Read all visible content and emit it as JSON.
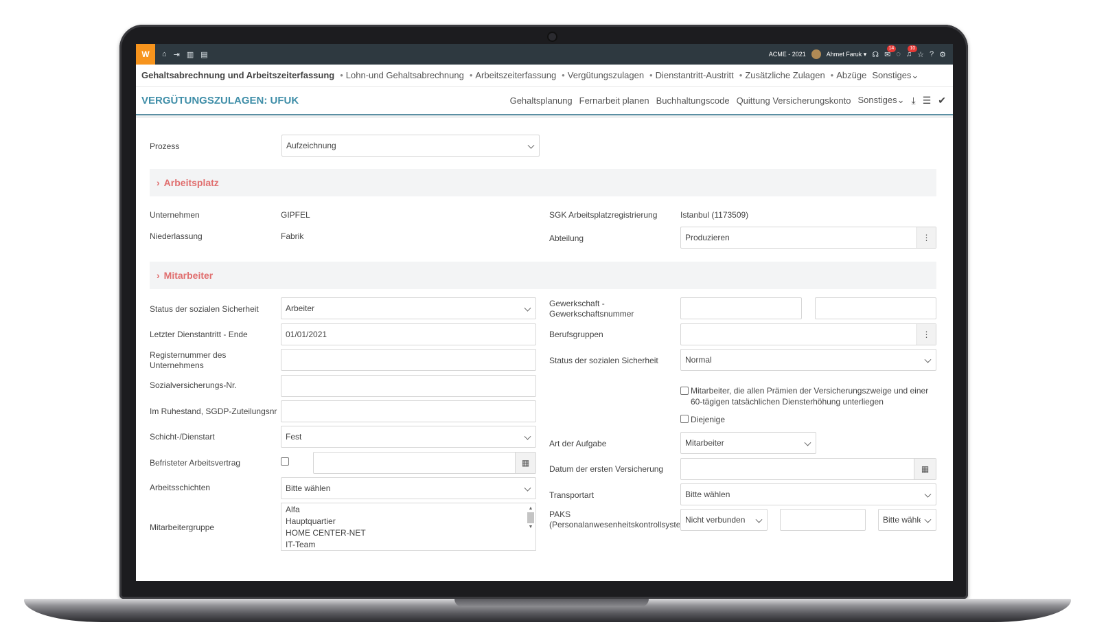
{
  "topbar": {
    "logo": "W",
    "company": "ACME - 2021",
    "user": "Ahmet Faruk",
    "messages_badge": "14",
    "notifications_badge": "10",
    "icons": [
      "home-icon",
      "logout-icon",
      "chart-icon",
      "calendar-icon"
    ]
  },
  "nav": {
    "items": [
      "Gehaltsabrechnung und Arbeitszeiterfassung",
      "Lohn-und Gehaltsabrechnung",
      "Arbeitszeiterfassung",
      "Vergütungszulagen",
      "Dienstantritt-Austritt",
      "Zusätzliche Zulagen",
      "Abzüge",
      "Sonstiges"
    ]
  },
  "title": {
    "text": "VERGÜTUNGSZULAGEN: UFUK",
    "links": [
      "Gehaltsplanung",
      "Fernarbeit planen",
      "Buchhaltungscode",
      "Quittung Versicherungskonto",
      "Sonstiges"
    ]
  },
  "prozess": {
    "label": "Prozess",
    "value": "Aufzeichnung"
  },
  "arbeitsplatz": {
    "title": "Arbeitsplatz",
    "unternehmen_label": "Unternehmen",
    "unternehmen_value": "GIPFEL",
    "niederlassung_label": "Niederlassung",
    "niederlassung_value": "Fabrik",
    "sgk_label": "SGK Arbeitsplatzregistrierung",
    "sgk_value": "Istanbul (1173509)",
    "abteilung_label": "Abteilung",
    "abteilung_value": "Produzieren"
  },
  "mitarbeiter": {
    "title": "Mitarbeiter",
    "status_label": "Status der sozialen Sicherheit",
    "status_value": "Arbeiter",
    "letzter_label": "Letzter Dienstantritt - Ende",
    "letzter_value": "01/01/2021",
    "register_label": "Registernummer des Unternehmens",
    "sozial_label": "Sozialversicherungs-Nr.",
    "ruhestand_label": "Im Ruhestand, SGDP-Zuteilungsnr",
    "schicht_label": "Schicht-/Dienstart",
    "schicht_value": "Fest",
    "befristet_label": "Befristeter Arbeitsvertrag",
    "arbeitsschichten_label": "Arbeitsschichten",
    "arbeitsschichten_value": "Bitte wählen",
    "gruppe_label": "Mitarbeitergruppe",
    "gruppe_options": [
      "Alfa",
      "Hauptquartier",
      "HOME CENTER-NET",
      "IT-Team"
    ],
    "gewerkschaft_label": "Gewerkschaft - Gewerkschaftsnummer",
    "berufsgruppen_label": "Berufsgruppen",
    "status2_label": "Status der sozialen Sicherheit",
    "status2_value": "Normal",
    "check1_label": "Mitarbeiter, die allen Prämien der Versicherungszweige und einer 60-tägigen tatsächlichen Diensterhöhung unterliegen",
    "check2_label": "Diejenige",
    "aufgabe_label": "Art der Aufgabe",
    "aufgabe_value": "Mitarbeiter",
    "datum_label": "Datum der ersten Versicherung",
    "transport_label": "Transportart",
    "transport_value": "Bitte wählen",
    "paks_label": "PAKS (Personalanwesenheitskontrollsystem)",
    "paks_status": "Nicht verbunden",
    "paks_select": "Bitte wählen"
  }
}
